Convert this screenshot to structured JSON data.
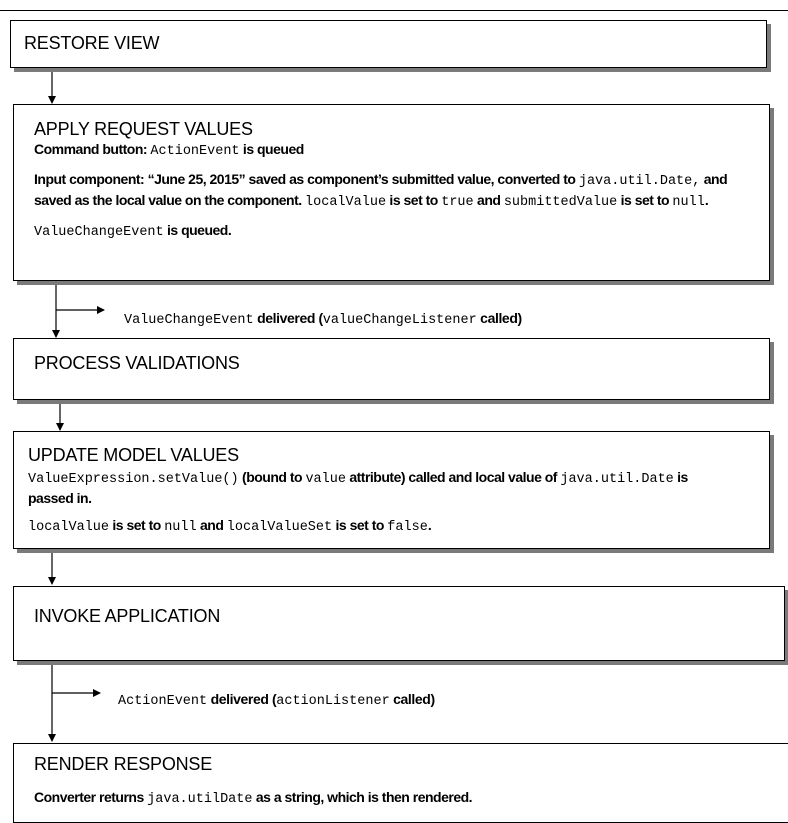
{
  "phases": {
    "restore_view": {
      "title": "RESTORE VIEW"
    },
    "apply_request_values": {
      "title": "APPLY REQUEST VALUES",
      "line1": {
        "t1": "Command button: ",
        "c1": "ActionEvent",
        "t2": " is queued"
      },
      "line2": {
        "t1": "Input component: “June 25, 2015” saved as component’s submitted value, converted to ",
        "c1": "java.util.Date,",
        "t2": " and saved as the local value on the component. ",
        "c2": "localValue",
        "t3": " is set to ",
        "c3": "true",
        "t4": " and ",
        "c4": "submittedValue",
        "t5": " is set to ",
        "c5": "null",
        "t6": "."
      },
      "line3": {
        "c1": "ValueChangeEvent",
        "t1": " is queued."
      }
    },
    "process_validations": {
      "title": "PROCESS VALIDATIONS"
    },
    "update_model_values": {
      "title": "UPDATE MODEL VALUES",
      "line1": {
        "c1": "ValueExpression.setValue()",
        "t1": " (bound to ",
        "c2": "value",
        "t2": " attribute) called and local value of ",
        "c3": "java.util.Date",
        "t3": " is passed in."
      },
      "line2": {
        "c1": "localValue",
        "t1": " is set to ",
        "c2": "null",
        "t2": " and ",
        "c3": "localValueSet",
        "t3": " is set to ",
        "c4": "false",
        "t4": "."
      }
    },
    "invoke_application": {
      "title": "INVOKE APPLICATION"
    },
    "render_response": {
      "title": "RENDER RESPONSE",
      "line1": {
        "t1": "Converter returns ",
        "c1": "java.utilDate",
        "t2": " as a string, which is then rendered."
      }
    }
  },
  "events": {
    "value_change": {
      "c1": "ValueChangeEvent",
      "t1": " delivered (",
      "c2": "valueChangeListener",
      "t2": " called)"
    },
    "action": {
      "c1": "ActionEvent",
      "t1": " delivered (",
      "c2": "actionListener",
      "t2": " called)"
    }
  }
}
